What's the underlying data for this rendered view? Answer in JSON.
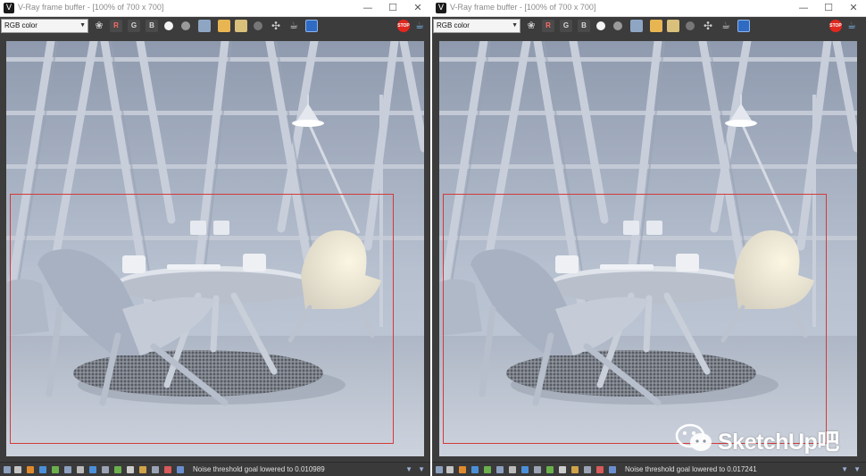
{
  "windows": [
    {
      "title": "V-Ray frame buffer - [100% of 700 x 700]",
      "channel": "RGB color",
      "channel_buttons": {
        "r": "R",
        "g": "G",
        "b": "B"
      },
      "window_controls": {
        "minimize": "—",
        "maximize": "☐",
        "close": "✕"
      },
      "status_text": "Noise threshold goal lowered to 0.010989",
      "status_right": "▼"
    },
    {
      "title": "V-Ray frame buffer - [100% of 700 x 700]",
      "channel": "RGB color",
      "channel_buttons": {
        "r": "R",
        "g": "G",
        "b": "B"
      },
      "window_controls": {
        "minimize": "—",
        "maximize": "☐",
        "close": "✕"
      },
      "status_text": "Noise threshold goal lowered to 0.017241",
      "status_right": "▼"
    }
  ],
  "watermark": {
    "text": "SketchUp吧"
  },
  "colors": {
    "region_outline": "#d23a3a",
    "chrome_dark": "#3c3c3c",
    "titlebar": "#ffffff"
  },
  "icons": [
    "vray-logo-icon",
    "color-corrections-icon",
    "save-image-icon",
    "load-image-icon",
    "clear-image-icon",
    "region-render-icon",
    "stop-render-icon",
    "render-icon"
  ]
}
